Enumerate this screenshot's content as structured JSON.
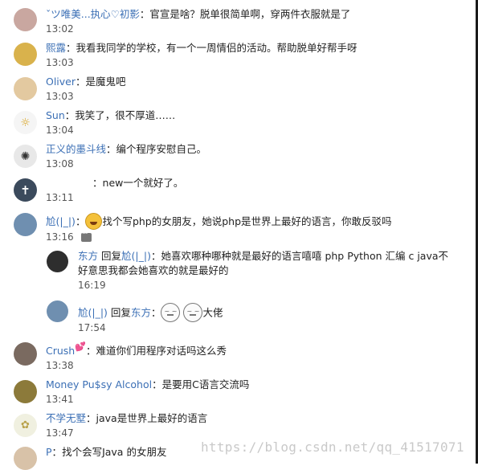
{
  "comments": [
    {
      "name": "ˇツ唯美...执心♡初影",
      "sep": "：",
      "text": "官宣是啥？脱单很简单啊，穿两件衣服就是了",
      "time": "13:02",
      "avatar_color": "#c9a7a0"
    },
    {
      "name": "熙露",
      "sep": "：",
      "text": "我看我同学的学校，有一个一周情侣的活动。帮助脱单好帮手呀",
      "time": "13:03",
      "avatar_color": "#d9b24c"
    },
    {
      "name": "Oliver",
      "sep": "：",
      "text": "是魔鬼吧",
      "time": "13:03",
      "avatar_color": "#e3c9a0"
    },
    {
      "name": "Sun",
      "sep": "：",
      "text": "我笑了，很不厚道……",
      "time": "13:04",
      "avatar_color": "#f5f5f5"
    },
    {
      "name": "正义的墨斗线",
      "sep": "：",
      "text": "编个程序安慰自己。",
      "time": "13:08",
      "avatar_color": "#8a8a8a"
    },
    {
      "name": "",
      "sep": "：",
      "text": "new一个就好了。",
      "time": "13:11",
      "avatar_color": "#3b4a5c"
    },
    {
      "name": "尬(|_|)",
      "sep": "：",
      "text_before": "",
      "text": "找个写php的女朋友，她说php是世界上最好的语言，你敢反驳吗",
      "time": "13:16",
      "avatar_color": "#6f8fb0",
      "emoji": "laugh-emoji"
    },
    {
      "name": "Crush",
      "sep": "：",
      "text": "难道你们用程序对话吗这么秀",
      "time": "13:38",
      "avatar_color": "#7a6a60"
    },
    {
      "name": "Money Pu$sy Alcohol",
      "sep": "：",
      "text": "是要用C语言交流吗",
      "time": "13:41",
      "avatar_color": "#8c7a3a"
    },
    {
      "name": "不学无墅",
      "sep": "：",
      "text": "java是世界上最好的语言",
      "time": "13:47",
      "avatar_color": "#f0f0e0"
    },
    {
      "name": "P",
      "sep": "：",
      "text": "找个会写Java 的女朋友",
      "time": "",
      "avatar_color": "#d8c2a8"
    }
  ],
  "replies": [
    {
      "name": "东方",
      "reply_word": "回复",
      "target": "尬(|_|)",
      "sep": "：",
      "text_line1": "她喜欢哪种哪种就是最好的语言嘻嘻 php Python 汇编 c java不",
      "text_line2": "好意思我都会她喜欢的就是最好的",
      "time": "16:19",
      "avatar_color": "#2e2e2e"
    },
    {
      "name": "尬(|_|)",
      "reply_word": "回复",
      "target": "东方",
      "sep": "：",
      "text": "大佬",
      "time": "17:54",
      "avatar_color": "#6f8fb0",
      "emoji": "meh-emoji"
    }
  ],
  "watermark": "https://blog.csdn.net/qq_41517071",
  "colors": {
    "name": "#3b6fb5",
    "text": "#222222",
    "time": "#555555",
    "watermark": "#c9c9c9"
  }
}
